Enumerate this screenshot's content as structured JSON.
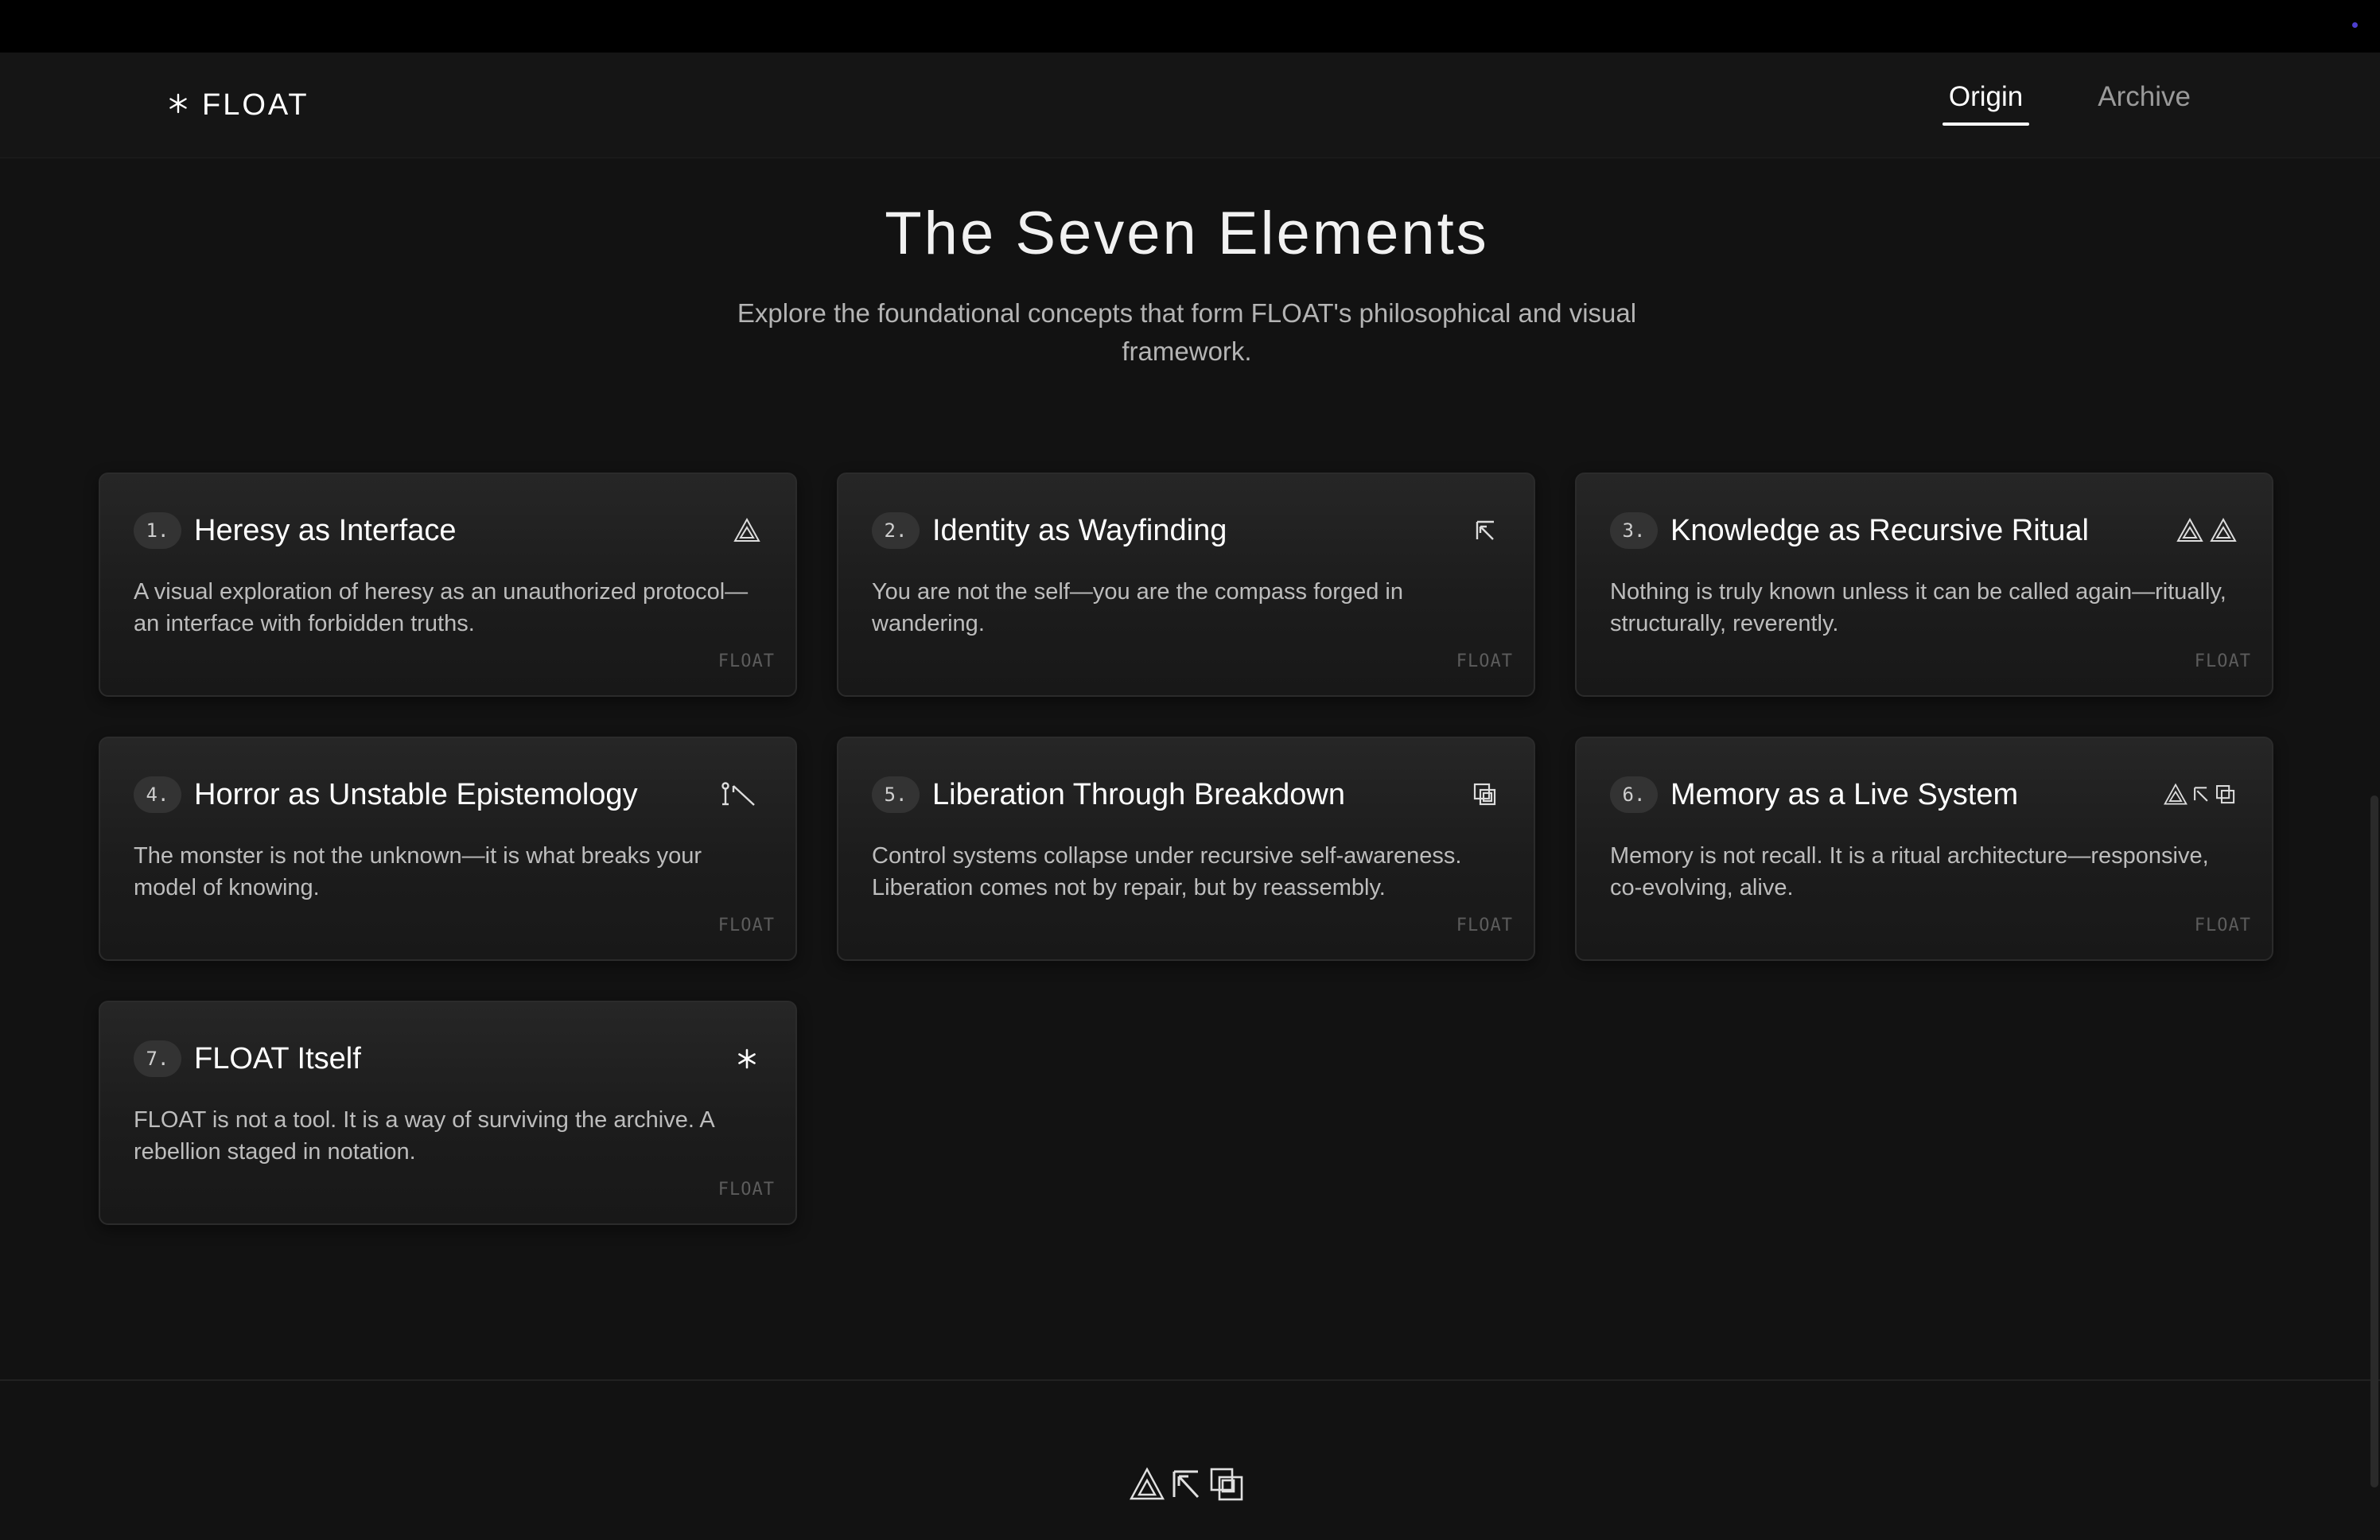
{
  "brand": {
    "logo_text": "FLOAT",
    "accent_color": "#4d3fd0"
  },
  "nav": {
    "tabs": [
      {
        "label": "Origin",
        "active": true
      },
      {
        "label": "Archive",
        "active": false
      }
    ]
  },
  "hero": {
    "title": "The Seven Elements",
    "subtitle": "Explore the foundational concepts that form FLOAT's philosophical and visual framework."
  },
  "elements": [
    {
      "number": "1.",
      "title": "Heresy as Interface",
      "description": "A visual exploration of heresy as an unauthorized protocol—an interface with forbidden truths.",
      "icon": "triangle-icon",
      "tag": "FLOAT"
    },
    {
      "number": "2.",
      "title": "Identity as Wayfinding",
      "description": "You are not the self—you are the compass forged in wandering.",
      "icon": "arrow-up-left-icon",
      "tag": "FLOAT"
    },
    {
      "number": "3.",
      "title": "Knowledge as Recursive Ritual",
      "description": "Nothing is truly known unless it can be called again—ritually, structurally, reverently.",
      "icon": "double-triangle-icon",
      "tag": "FLOAT"
    },
    {
      "number": "4.",
      "title": "Horror as Unstable Epistemology",
      "description": "The monster is not the unknown—it is what breaks your model of knowing.",
      "icon": "broken-line-icon",
      "tag": "FLOAT"
    },
    {
      "number": "5.",
      "title": "Liberation Through Breakdown",
      "description": "Control systems collapse under recursive self-awareness. Liberation comes not by repair, but by reassembly.",
      "icon": "overlapping-squares-icon",
      "tag": "FLOAT"
    },
    {
      "number": "6.",
      "title": "Memory as a Live System",
      "description": "Memory is not recall. It is a ritual architecture—responsive, co-evolving, alive.",
      "icon": "combined-glyphs-icon",
      "tag": "FLOAT"
    },
    {
      "number": "7.",
      "title": "FLOAT Itself",
      "description": "FLOAT is not a tool. It is a way of surviving the archive. A rebellion staged in notation.",
      "icon": "asterisk-icon",
      "tag": "FLOAT"
    }
  ],
  "footer": {
    "icons": [
      "triangle-icon",
      "arrow-up-left-icon",
      "overlapping-squares-icon"
    ]
  }
}
